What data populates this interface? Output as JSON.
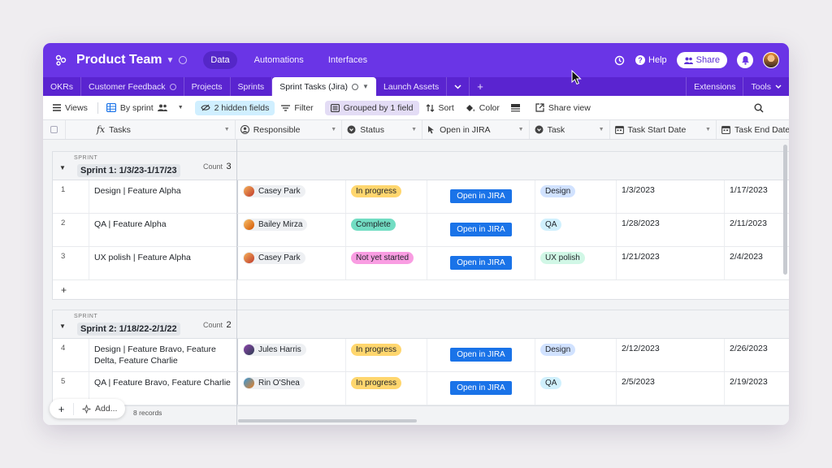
{
  "header": {
    "base_title": "Product Team",
    "mode_tabs": [
      {
        "label": "Data",
        "active": true
      },
      {
        "label": "Automations",
        "active": false
      },
      {
        "label": "Interfaces",
        "active": false
      }
    ],
    "help_label": "Help",
    "share_label": "Share",
    "brand_color": "#6a35e6"
  },
  "table_tabs": {
    "items": [
      "OKRs",
      "Customer Feedback",
      "Projects",
      "Sprints",
      "Sprint Tasks (Jira)",
      "Launch Assets"
    ],
    "active": "Sprint Tasks (Jira)",
    "right": [
      "Extensions",
      "Tools"
    ]
  },
  "toolbar": {
    "views": "Views",
    "grouping_view": "By sprint",
    "hidden_fields": "2 hidden fields",
    "filter": "Filter",
    "grouped": "Grouped by 1 field",
    "sort": "Sort",
    "color": "Color",
    "share_view": "Share view"
  },
  "columns": [
    "Tasks",
    "Responsible",
    "Status",
    "Open in JIRA",
    "Task",
    "Task Start Date",
    "Task End Date"
  ],
  "groups": [
    {
      "kicker": "SPRINT",
      "title": "Sprint 1: 1/3/23-1/17/23",
      "count_label": "Count",
      "count": "3",
      "rows": [
        {
          "n": "1",
          "task": "Design | Feature Alpha",
          "person": "Casey Park",
          "status": "In progress",
          "jira": "Open in JIRA",
          "tag": "Design",
          "start": "1/3/2023",
          "end": "1/17/2023"
        },
        {
          "n": "2",
          "task": "QA | Feature Alpha",
          "person": "Bailey Mirza",
          "status": "Complete",
          "jira": "Open in JIRA",
          "tag": "QA",
          "start": "1/28/2023",
          "end": "2/11/2023"
        },
        {
          "n": "3",
          "task": "UX polish | Feature Alpha",
          "person": "Casey Park",
          "status": "Not yet started",
          "jira": "Open in JIRA",
          "tag": "UX polish",
          "start": "1/21/2023",
          "end": "2/4/2023"
        }
      ]
    },
    {
      "kicker": "SPRINT",
      "title": "Sprint 2: 1/18/22-2/1/22",
      "count_label": "Count",
      "count": "2",
      "rows": [
        {
          "n": "4",
          "task": "Design | Feature Bravo, Feature Delta, Feature Charlie",
          "person": "Jules Harris",
          "status": "In progress",
          "jira": "Open in JIRA",
          "tag": "Design",
          "start": "2/12/2023",
          "end": "2/26/2023"
        },
        {
          "n": "5",
          "task": "QA | Feature Bravo, Feature Charlie",
          "person": "Rin O'Shea",
          "status": "In progress",
          "jira": "Open in JIRA",
          "tag": "QA",
          "start": "2/5/2023",
          "end": "2/19/2023"
        }
      ]
    }
  ],
  "footer": {
    "add_label": "Add...",
    "records": "8 records",
    "add_row": "+"
  },
  "status_colors": {
    "In progress": "#ffd66e",
    "Complete": "#72ddc3",
    "Not yet started": "#f99de2"
  },
  "tag_colors": {
    "Design": "#d1e2ff",
    "QA": "#d0f0fd",
    "UX polish": "#d1f7e6"
  }
}
